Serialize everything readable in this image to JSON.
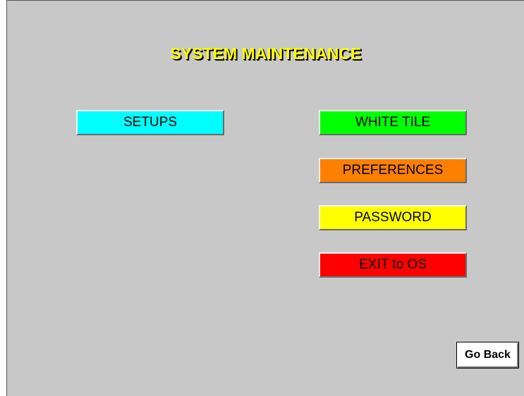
{
  "screen": {
    "title": "SYSTEM MAINTENANCE",
    "title_color": "#ffff00",
    "background_color": "#c8c8c8"
  },
  "buttons": {
    "setups": {
      "label": "SETUPS",
      "color": "#00ffff"
    },
    "white_tile": {
      "label": "WHITE TILE",
      "color": "#00ff00"
    },
    "preferences": {
      "label": "PREFERENCES",
      "color": "#ff8000"
    },
    "password": {
      "label": "PASSWORD",
      "color": "#ffff00"
    },
    "exit_to_os": {
      "label": "EXIT to OS",
      "color": "#ff0000"
    },
    "go_back": {
      "label": "Go Back"
    }
  }
}
